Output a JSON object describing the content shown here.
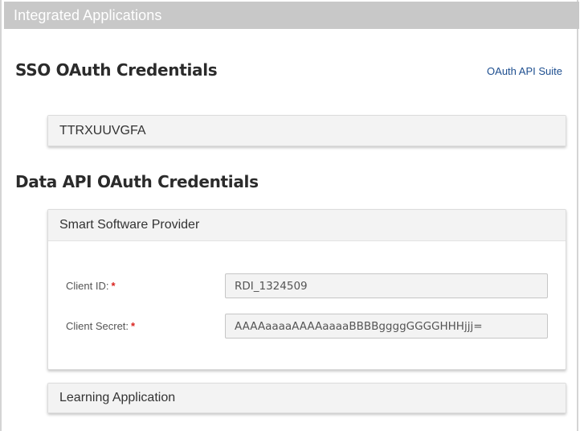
{
  "header": {
    "title": "Integrated Applications"
  },
  "sso_section": {
    "title": "SSO OAuth Credentials",
    "api_suite_link": "OAuth API Suite",
    "apps": [
      {
        "name": "TTRXUUVGFA"
      }
    ]
  },
  "data_api_section": {
    "title": "Data API OAuth Credentials",
    "apps": [
      {
        "name": "Smart Software Provider",
        "client_id_label": "Client ID:",
        "client_id_value": "RDI_1324509",
        "client_secret_label": "Client Secret:",
        "client_secret_value": "AAAAaaaaAAAAaaaaBBBBggggGGGGHHHjjj=",
        "required_marker": "*"
      },
      {
        "name": "Learning Application"
      }
    ]
  }
}
